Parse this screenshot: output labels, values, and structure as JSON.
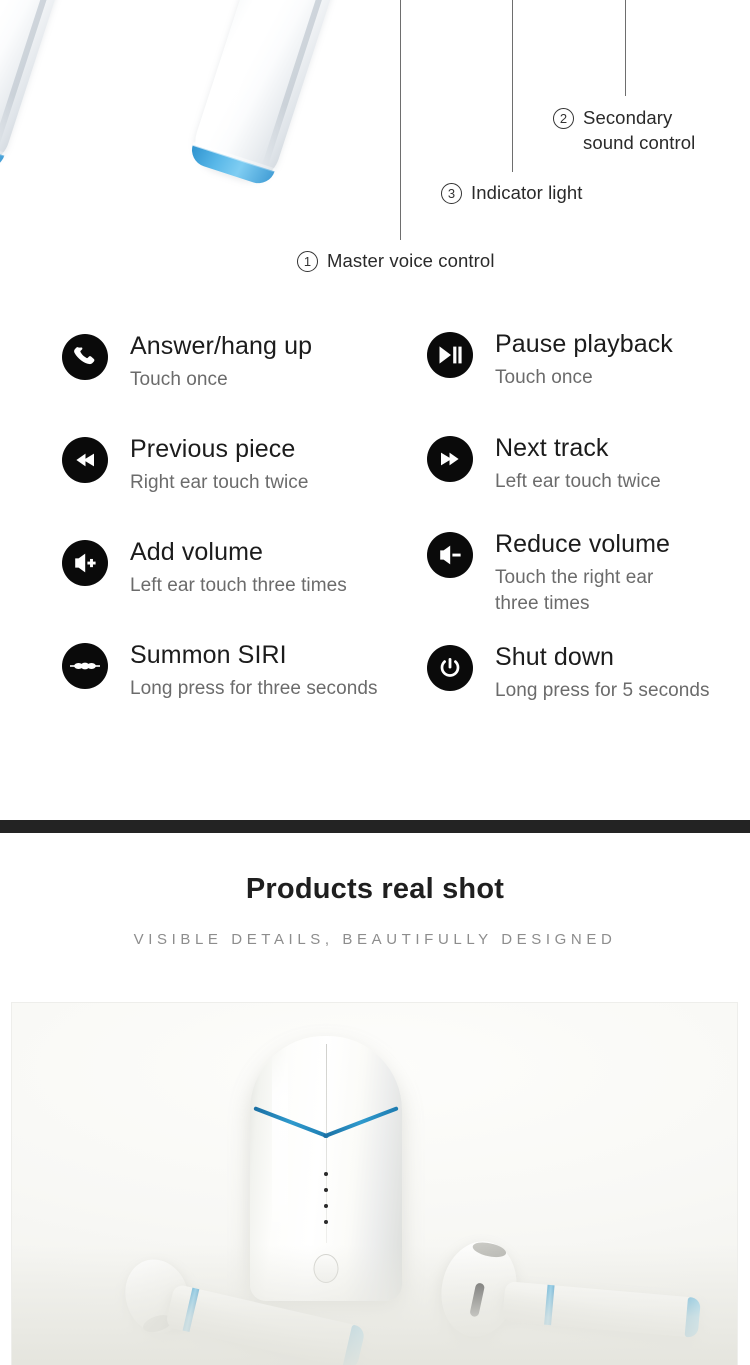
{
  "diagram": {
    "callouts": [
      {
        "num": "1",
        "label": "Master voice control",
        "icon": "circle-number-icon"
      },
      {
        "num": "2",
        "label": "Secondary\nsound control",
        "icon": "circle-number-icon"
      },
      {
        "num": "3",
        "label": "Indicator light",
        "icon": "circle-number-icon"
      }
    ]
  },
  "features": {
    "left": [
      {
        "icon": "phone-handset-icon",
        "title": "Answer/hang up",
        "desc": "Touch once"
      },
      {
        "icon": "previous-track-icon",
        "title": "Previous piece",
        "desc": "Right ear touch twice"
      },
      {
        "icon": "volume-up-icon",
        "title": "Add volume",
        "desc": "Left ear touch three times"
      },
      {
        "icon": "voice-waveform-icon",
        "title": "Summon SIRI",
        "desc": "Long press for three seconds"
      }
    ],
    "right": [
      {
        "icon": "play-pause-icon",
        "title": "Pause playback",
        "desc": "Touch once"
      },
      {
        "icon": "next-track-icon",
        "title": "Next track",
        "desc": "Left ear touch twice"
      },
      {
        "icon": "volume-down-icon",
        "title": "Reduce volume",
        "desc": "Touch the right ear three times"
      },
      {
        "icon": "power-icon",
        "title": "Shut down",
        "desc": "Long press for 5 seconds"
      }
    ]
  },
  "real_shot": {
    "title": "Products real shot",
    "subtitle": "VISIBLE DETAILS, BEAUTIFULLY DESIGNED"
  },
  "colors": {
    "accent_blue": "#2f9acd",
    "bright_blue": "#58b7e8",
    "divider_dark": "#232323",
    "title_text": "#1c1c1c",
    "desc_text": "#6b6b6b",
    "subtitle_text": "#8d8d8d",
    "icon_bg": "#0a0a0a"
  }
}
